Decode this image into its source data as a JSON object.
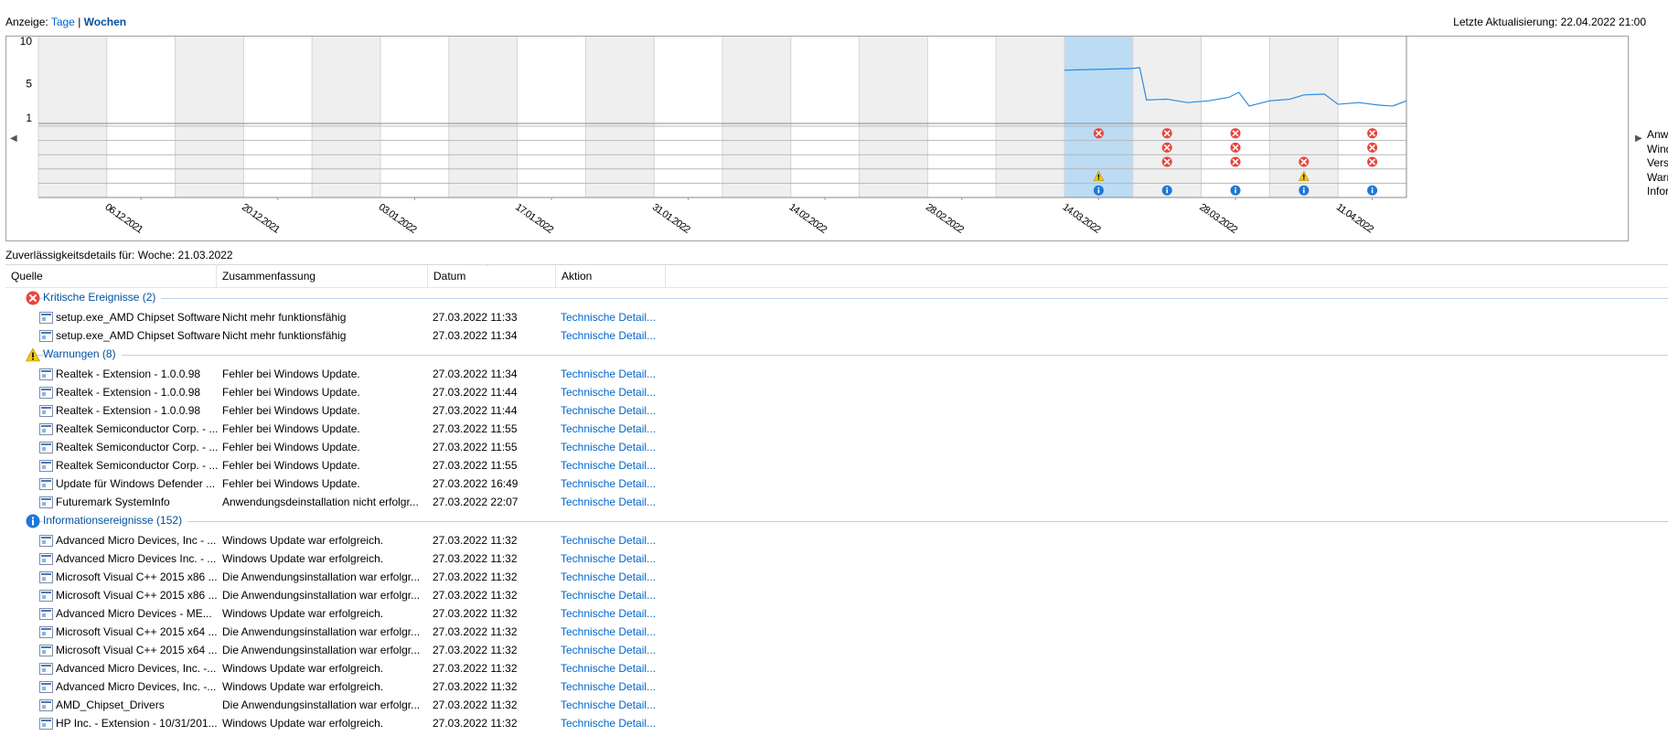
{
  "view": {
    "label": "Anzeige:",
    "days": "Tage",
    "separator": "|",
    "weeks": "Wochen"
  },
  "last_update": "Letzte Aktualisierung: 22.04.2022 21:00",
  "chart": {
    "y_ticks": [
      "10",
      "5",
      "1"
    ],
    "x_labels": [
      "06.12.2021",
      "20.12.2021",
      "03.01.2022",
      "17.01.2022",
      "31.01.2022",
      "14.02.2022",
      "28.02.2022",
      "14.03.2022",
      "28.03.2022",
      "11.04.2022"
    ],
    "legend": [
      "Anwendungsfehler",
      "Windows-Fehler",
      "Verschiedene Fehler",
      "Warnungen",
      "Informationen"
    ],
    "selected_week": 15,
    "status_colors": {
      "error": "#e8453c",
      "warning": "#f2c811",
      "info": "#1e78d6",
      "line": "#2b8ce0",
      "selection": "#bcdcf4"
    }
  },
  "chart_data": {
    "type": "line",
    "title": "",
    "ylim": [
      1,
      10
    ],
    "yticks": [
      1,
      5,
      10
    ],
    "series": [
      {
        "values": [
          {
            "x": 15.0,
            "y": 6.6
          },
          {
            "x": 16.0,
            "y": 6.8
          },
          {
            "x": 16.1,
            "y": 6.9
          },
          {
            "x": 16.2,
            "y": 3.1
          },
          {
            "x": 16.5,
            "y": 3.2
          },
          {
            "x": 16.8,
            "y": 2.8
          },
          {
            "x": 17.1,
            "y": 3.0
          },
          {
            "x": 17.4,
            "y": 3.4
          },
          {
            "x": 17.55,
            "y": 4.0
          },
          {
            "x": 17.7,
            "y": 2.4
          },
          {
            "x": 18.0,
            "y": 3.0
          },
          {
            "x": 18.3,
            "y": 3.2
          },
          {
            "x": 18.5,
            "y": 3.7
          },
          {
            "x": 18.8,
            "y": 3.8
          },
          {
            "x": 19.0,
            "y": 2.6
          },
          {
            "x": 19.3,
            "y": 2.8
          },
          {
            "x": 19.6,
            "y": 2.5
          },
          {
            "x": 19.8,
            "y": 2.4
          },
          {
            "x": 20.0,
            "y": 3.0
          }
        ]
      }
    ],
    "events": {
      "application_errors": [
        15,
        16,
        17,
        19
      ],
      "windows_errors": [
        16,
        17,
        19
      ],
      "misc_errors": [
        16,
        17,
        18,
        19
      ],
      "warnings": [
        15,
        18
      ],
      "information": [
        15,
        16,
        17,
        18,
        19
      ]
    }
  },
  "details_title": "Zuverlässigkeitsdetails für: Woche: 21.03.2022",
  "columns": [
    "Quelle",
    "Zusammenfassung",
    "Datum",
    "Aktion"
  ],
  "groups": [
    {
      "type": "error",
      "label": "Kritische Ereignisse (2)",
      "rows": [
        [
          "setup.exe_AMD Chipset Software",
          "Nicht mehr funktionsfähig",
          "27.03.2022 11:33",
          "Technische Detail..."
        ],
        [
          "setup.exe_AMD Chipset Software",
          "Nicht mehr funktionsfähig",
          "27.03.2022 11:34",
          "Technische Detail..."
        ]
      ]
    },
    {
      "type": "warning",
      "label": "Warnungen (8)",
      "rows": [
        [
          "Realtek - Extension - 1.0.0.98",
          "Fehler bei Windows Update.",
          "27.03.2022 11:34",
          "Technische Detail..."
        ],
        [
          "Realtek - Extension - 1.0.0.98",
          "Fehler bei Windows Update.",
          "27.03.2022 11:44",
          "Technische Detail..."
        ],
        [
          "Realtek - Extension - 1.0.0.98",
          "Fehler bei Windows Update.",
          "27.03.2022 11:44",
          "Technische Detail..."
        ],
        [
          "Realtek Semiconductor Corp. - ...",
          "Fehler bei Windows Update.",
          "27.03.2022 11:55",
          "Technische Detail..."
        ],
        [
          "Realtek Semiconductor Corp. - ...",
          "Fehler bei Windows Update.",
          "27.03.2022 11:55",
          "Technische Detail..."
        ],
        [
          "Realtek Semiconductor Corp. - ...",
          "Fehler bei Windows Update.",
          "27.03.2022 11:55",
          "Technische Detail..."
        ],
        [
          "Update für Windows Defender ...",
          "Fehler bei Windows Update.",
          "27.03.2022 16:49",
          "Technische Detail..."
        ],
        [
          "Futuremark SystemInfo",
          "Anwendungsdeinstallation nicht erfolgr...",
          "27.03.2022 22:07",
          "Technische Detail..."
        ]
      ]
    },
    {
      "type": "info",
      "label": "Informationsereignisse (152)",
      "rows": [
        [
          "Advanced Micro Devices, Inc - ...",
          "Windows Update war erfolgreich.",
          "27.03.2022 11:32",
          "Technische Detail..."
        ],
        [
          "Advanced Micro Devices Inc. - ...",
          "Windows Update war erfolgreich.",
          "27.03.2022 11:32",
          "Technische Detail..."
        ],
        [
          "Microsoft Visual C++ 2015 x86 ...",
          "Die Anwendungsinstallation war erfolgr...",
          "27.03.2022 11:32",
          "Technische Detail..."
        ],
        [
          "Microsoft Visual C++ 2015 x86 ...",
          "Die Anwendungsinstallation war erfolgr...",
          "27.03.2022 11:32",
          "Technische Detail..."
        ],
        [
          "Advanced Micro Devices - ME...",
          "Windows Update war erfolgreich.",
          "27.03.2022 11:32",
          "Technische Detail..."
        ],
        [
          "Microsoft Visual C++ 2015 x64 ...",
          "Die Anwendungsinstallation war erfolgr...",
          "27.03.2022 11:32",
          "Technische Detail..."
        ],
        [
          "Microsoft Visual C++ 2015 x64 ...",
          "Die Anwendungsinstallation war erfolgr...",
          "27.03.2022 11:32",
          "Technische Detail..."
        ],
        [
          "Advanced Micro Devices, Inc. -...",
          "Windows Update war erfolgreich.",
          "27.03.2022 11:32",
          "Technische Detail..."
        ],
        [
          "Advanced Micro Devices, Inc. -...",
          "Windows Update war erfolgreich.",
          "27.03.2022 11:32",
          "Technische Detail..."
        ],
        [
          "AMD_Chipset_Drivers",
          "Die Anwendungsinstallation war erfolgr...",
          "27.03.2022 11:32",
          "Technische Detail..."
        ],
        [
          "HP Inc. - Extension - 10/31/201...",
          "Windows Update war erfolgreich.",
          "27.03.2022 11:32",
          "Technische Detail..."
        ]
      ]
    }
  ]
}
